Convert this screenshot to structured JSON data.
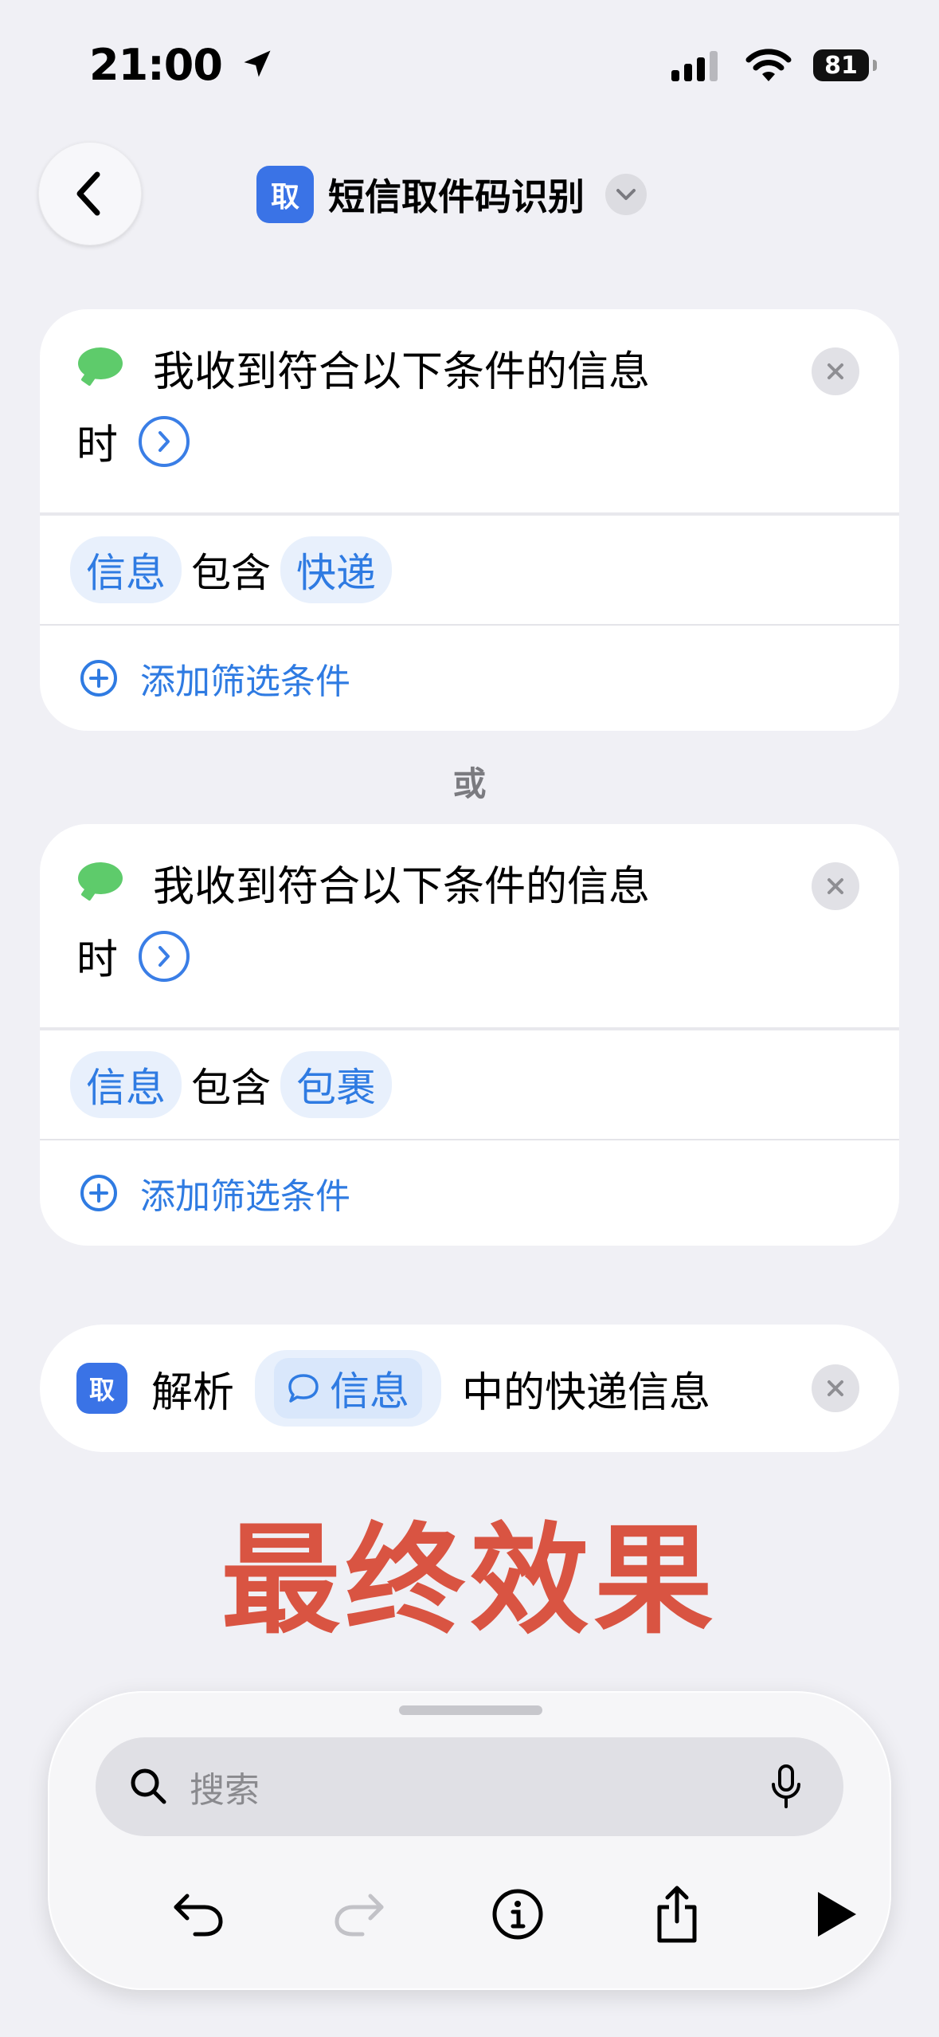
{
  "status_bar": {
    "time": "21:00",
    "battery": "81"
  },
  "header": {
    "title": "短信取件码识别",
    "app_icon_glyph": "取"
  },
  "triggers": [
    {
      "line1": "我收到符合以下条件的信息",
      "line2": "时",
      "condition": {
        "field": "信息",
        "operator": "包含",
        "value": "快递"
      },
      "add_filter_label": "添加筛选条件"
    },
    {
      "line1": "我收到符合以下条件的信息",
      "line2": "时",
      "condition": {
        "field": "信息",
        "operator": "包含",
        "value": "包裹"
      },
      "add_filter_label": "添加筛选条件"
    }
  ],
  "or_label": "或",
  "action": {
    "verb": "解析",
    "token": "信息",
    "suffix": "中的快递信息"
  },
  "final_label": "最终效果",
  "toolbar": {
    "search_placeholder": "搜索"
  },
  "icons": [
    "location-arrow-icon",
    "signal-icon",
    "wifi-icon",
    "battery-icon",
    "back-chevron-icon",
    "chevron-down-icon",
    "messages-icon",
    "chevron-right-circle-icon",
    "close-icon",
    "plus-circle-icon",
    "chat-bubble-icon",
    "search-icon",
    "microphone-icon",
    "undo-icon",
    "redo-icon",
    "info-icon",
    "share-icon",
    "play-icon"
  ],
  "colors": {
    "accent": "#2f7be2",
    "messages_green": "#5ecb6b",
    "final_label": "#d95442",
    "background": "#f0f0f5"
  }
}
